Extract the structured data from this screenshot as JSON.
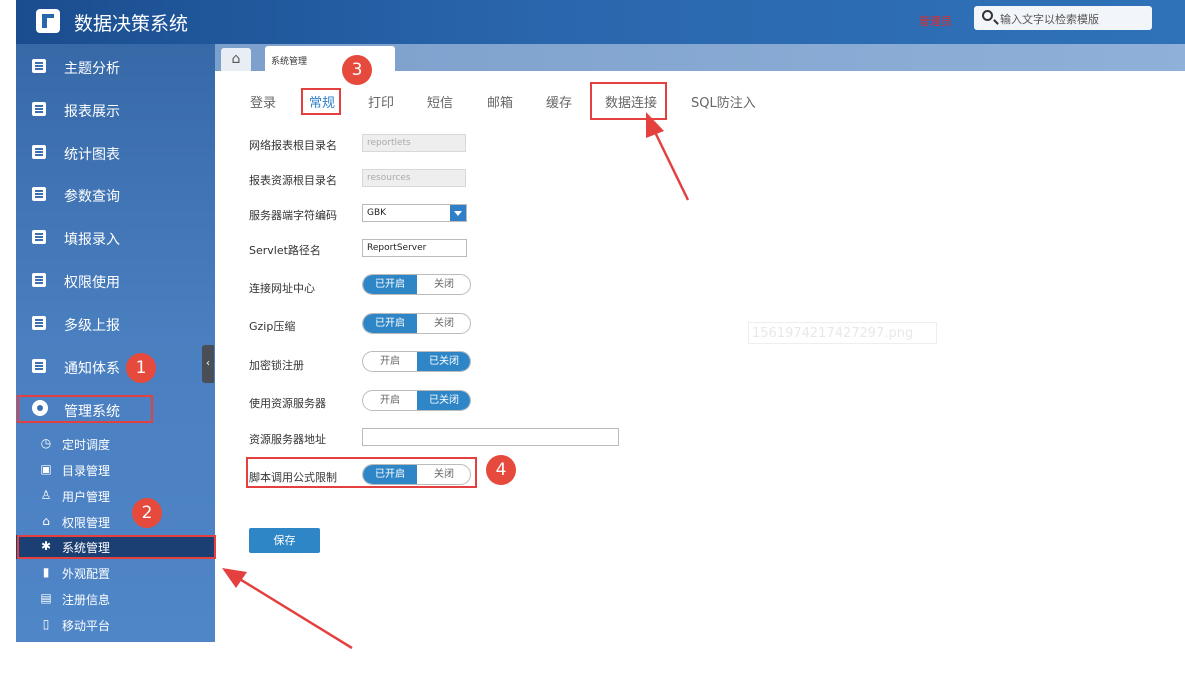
{
  "app": {
    "title": "数据决策系统"
  },
  "header": {
    "user_name": "管理员",
    "search_placeholder": "输入文字以检索模版"
  },
  "sidebar": {
    "items": [
      {
        "label": "主题分析"
      },
      {
        "label": "报表展示"
      },
      {
        "label": "统计图表"
      },
      {
        "label": "参数查询"
      },
      {
        "label": "填报录入"
      },
      {
        "label": "权限使用"
      },
      {
        "label": "多级上报"
      },
      {
        "label": "通知体系"
      },
      {
        "label": "管理系统"
      }
    ],
    "sub_items": [
      {
        "label": "定时调度",
        "icon": "clock-icon"
      },
      {
        "label": "目录管理",
        "icon": "folder-icon"
      },
      {
        "label": "用户管理",
        "icon": "user-icon"
      },
      {
        "label": "权限管理",
        "icon": "lock-icon"
      },
      {
        "label": "系统管理",
        "icon": "gear-icon",
        "active": true
      },
      {
        "label": "外观配置",
        "icon": "paint-roller-icon"
      },
      {
        "label": "注册信息",
        "icon": "register-icon"
      },
      {
        "label": "移动平台",
        "icon": "mobile-icon"
      }
    ]
  },
  "tabs": {
    "page_tab": "系统管理"
  },
  "subtabs": [
    "登录",
    "常规",
    "打印",
    "短信",
    "邮箱",
    "缓存",
    "数据连接",
    "SQL防注入"
  ],
  "form": {
    "report_root_label": "网络报表根目录名",
    "report_root_value": "reportlets",
    "resource_root_label": "报表资源根目录名",
    "resource_root_value": "resources",
    "encoding_label": "服务器端字符编码",
    "encoding_value": "GBK",
    "servlet_label": "Servlet路径名",
    "servlet_value": "ReportServer",
    "connect_center_label": "连接网址中心",
    "gzip_label": "Gzip压缩",
    "lock_label": "加密锁注册",
    "resource_server_label": "使用资源服务器",
    "resource_server_addr_label": "资源服务器地址",
    "script_limit_label": "脚本调用公式限制",
    "on_enabled": "已开启",
    "off": "关闭",
    "on": "开启",
    "off_enabled": "已关闭"
  },
  "buttons": {
    "save": "保存"
  },
  "watermark": "1561974217427297.png",
  "annotations": [
    "1",
    "2",
    "3",
    "4"
  ],
  "colors": {
    "accent": "#2f86c7",
    "highlight": "#e54040",
    "sidebar": "#4a7fc0"
  }
}
